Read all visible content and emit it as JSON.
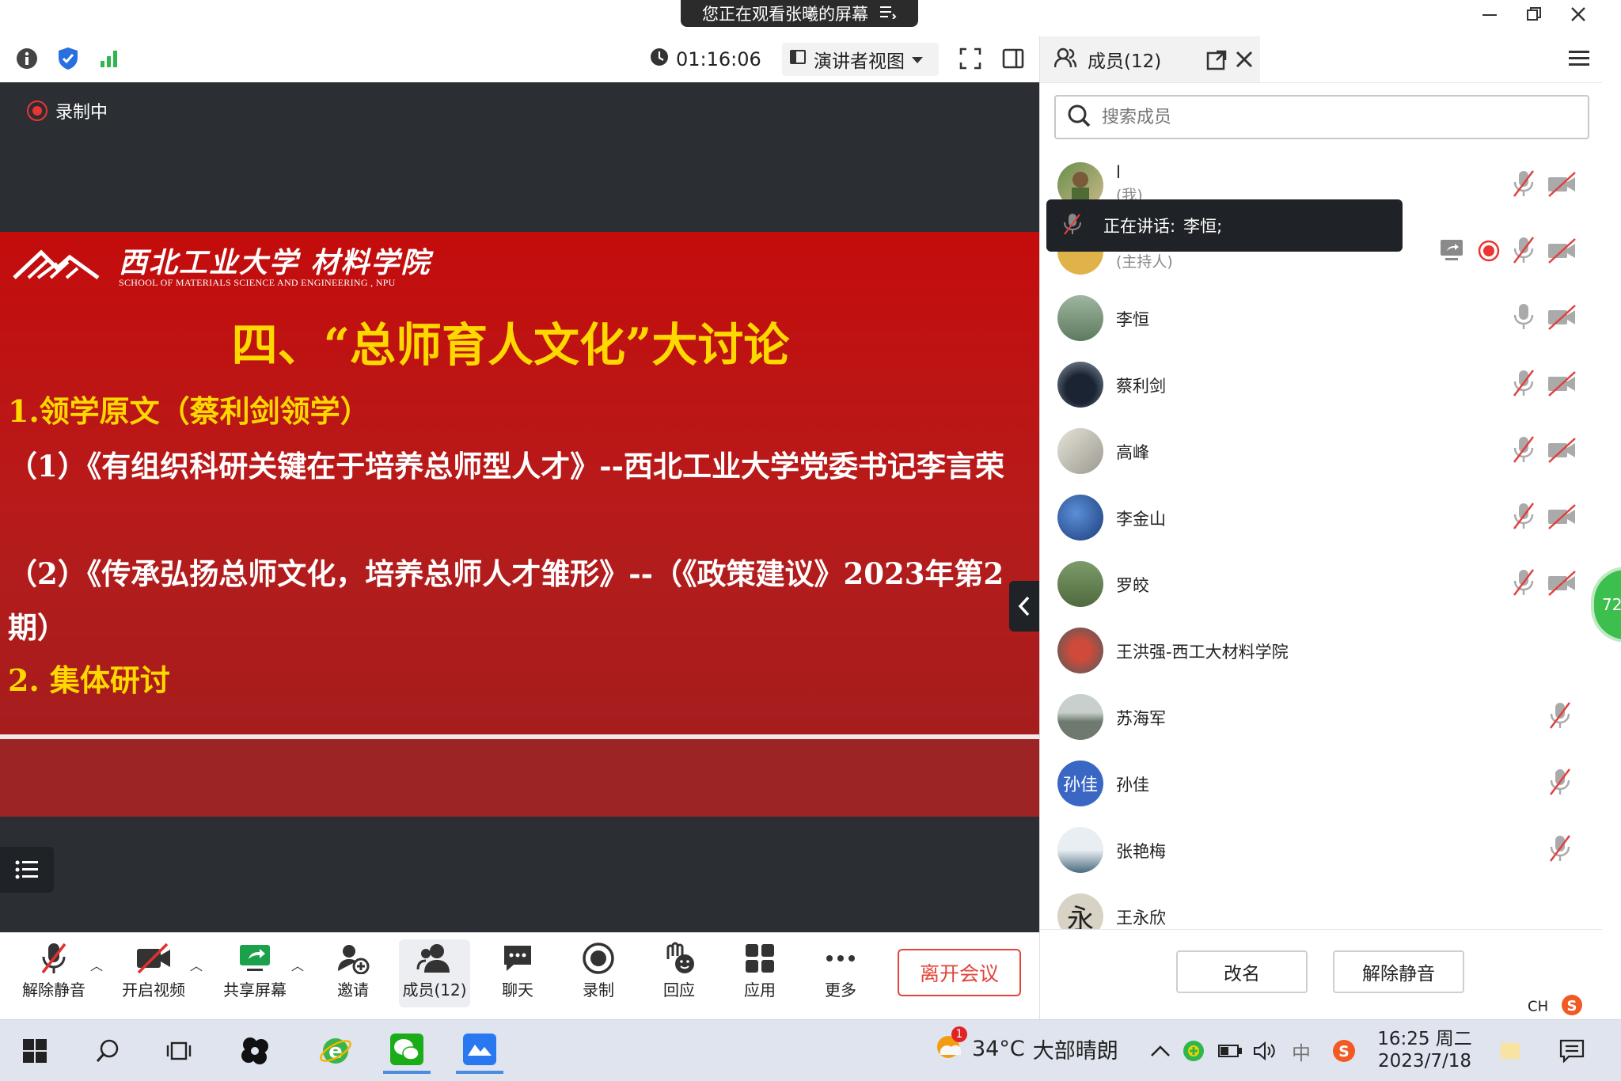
{
  "banner": {
    "text": "您正在观看张曦的屏幕"
  },
  "toolbar": {
    "timer": "01:16:06",
    "view_label": "演讲者视图"
  },
  "stage": {
    "recording_label": "录制中"
  },
  "slide": {
    "school_cn": "西北工业大学 材料学院",
    "school_en": "SCHOOL OF MATERIALS SCIENCE AND ENGINEERING , NPU",
    "title": "四、“总师育人文化”大讨论",
    "point1": "1.领学原文（蔡利剑领学）",
    "item1": "（1）《有组织科研关键在于培养总师型人才》--西北工业大学党委书记李言荣",
    "item2": "（2）《传承弘扬总师文化，培养总师人才雏形》--（《政策建议》2023年第2期）",
    "point2": "2. 集体研讨"
  },
  "controls": {
    "unmute": "解除静音",
    "start_video": "开启视频",
    "share_screen": "共享屏幕",
    "invite": "邀请",
    "members": "成员(12)",
    "chat": "聊天",
    "record": "录制",
    "react": "回应",
    "apps": "应用",
    "more": "更多",
    "leave": "离开会议"
  },
  "panel": {
    "title": "成员(12)",
    "search_placeholder": "搜索成员",
    "speaking_prefix": "正在讲话:",
    "speaking_name": "李恒;",
    "rename": "改名",
    "unmute_all": "解除静音",
    "members": [
      {
        "name": "l",
        "role": "(我)"
      },
      {
        "name": "",
        "role": "(主持人)"
      },
      {
        "name": "李恒",
        "role": ""
      },
      {
        "name": "蔡利剑",
        "role": ""
      },
      {
        "name": "高峰",
        "role": ""
      },
      {
        "name": "李金山",
        "role": ""
      },
      {
        "name": "罗皎",
        "role": ""
      },
      {
        "name": "王洪强-西工大材料学院",
        "role": ""
      },
      {
        "name": "苏海军",
        "role": ""
      },
      {
        "name": "孙佳",
        "role": "",
        "avatar_text": "孙佳"
      },
      {
        "name": "张艳梅",
        "role": ""
      },
      {
        "name": "王永欣",
        "role": "",
        "avatar_text": "永"
      }
    ]
  },
  "side_widget": {
    "value": "72"
  },
  "ime": {
    "label": "CH"
  },
  "taskbar": {
    "weather_badge": "1",
    "temperature": "34°C",
    "weather": "大部晴朗",
    "ime_char": "中",
    "time": "16:25 周二",
    "date": "2023/7/18"
  }
}
